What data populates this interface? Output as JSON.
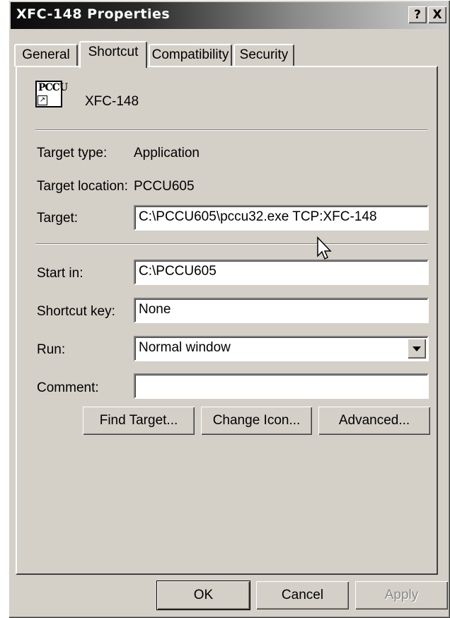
{
  "window": {
    "title": "XFC-148 Properties"
  },
  "titlebar_buttons": {
    "help": "?",
    "close": "X"
  },
  "tabs": [
    {
      "label": "General"
    },
    {
      "label": "Shortcut"
    },
    {
      "label": "Compatibility"
    },
    {
      "label": "Security"
    }
  ],
  "shortcut": {
    "name": "XFC-148",
    "icon": "pccu-shortcut-icon",
    "icon_text": "PCCU",
    "target_type_label": "Target type:",
    "target_type_value": "Application",
    "target_location_label": "Target location:",
    "target_location_value": "PCCU605",
    "target_label": "Target:",
    "target_value": "C:\\PCCU605\\pccu32.exe TCP:XFC-148",
    "start_in_label": "Start in:",
    "start_in_value": "C:\\PCCU605",
    "shortcut_key_label": "Shortcut key:",
    "shortcut_key_value": "None",
    "run_label": "Run:",
    "run_value": "Normal window",
    "comment_label": "Comment:",
    "comment_value": "",
    "find_target_button": "Find Target...",
    "change_icon_button": "Change Icon...",
    "advanced_button": "Advanced..."
  },
  "dialog_buttons": {
    "ok": "OK",
    "cancel": "Cancel",
    "apply": "Apply"
  },
  "colors": {
    "dialog_bg": "#d4d0c8",
    "title_dark": "#0a0a0a"
  }
}
